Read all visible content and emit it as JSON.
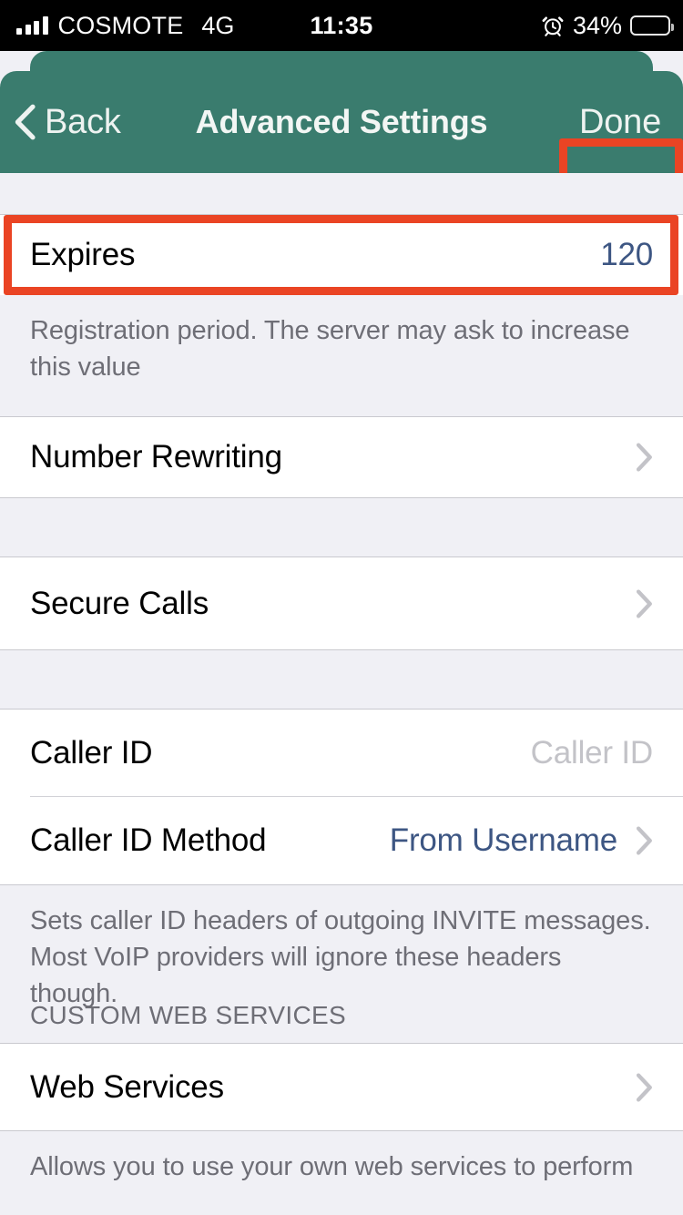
{
  "status_bar": {
    "carrier": "COSMOTE",
    "network": "4G",
    "time": "11:35",
    "battery_percent": "34%",
    "battery_level": 34,
    "signal_bars": 4,
    "alarm_icon": "alarm-clock-icon"
  },
  "nav": {
    "back_label": "Back",
    "title": "Advanced Settings",
    "done_label": "Done",
    "bar_color": "#3a7c6e",
    "highlight_color": "#ea4424"
  },
  "sections": {
    "expires": {
      "label": "Expires",
      "value": "120",
      "footer": "Registration period. The server may ask to increase this value"
    },
    "number_rewriting": {
      "label": "Number Rewriting"
    },
    "secure_calls": {
      "label": "Secure Calls"
    },
    "caller_id": {
      "label": "Caller ID",
      "placeholder": "Caller ID"
    },
    "caller_id_method": {
      "label": "Caller ID Method",
      "value": "From Username"
    },
    "caller_id_footer": "Sets caller ID headers of outgoing INVITE messages. Most VoIP providers will ignore these headers though.",
    "custom_web_services_header": "CUSTOM WEB SERVICES",
    "web_services": {
      "label": "Web Services"
    },
    "web_services_footer": "Allows you to use your own web services to perform"
  },
  "colors": {
    "accent_blue": "#3d5683",
    "muted_gray": "#6e6e76",
    "placeholder_gray": "#c3c3c8",
    "list_bg": "#f0f0f5"
  }
}
